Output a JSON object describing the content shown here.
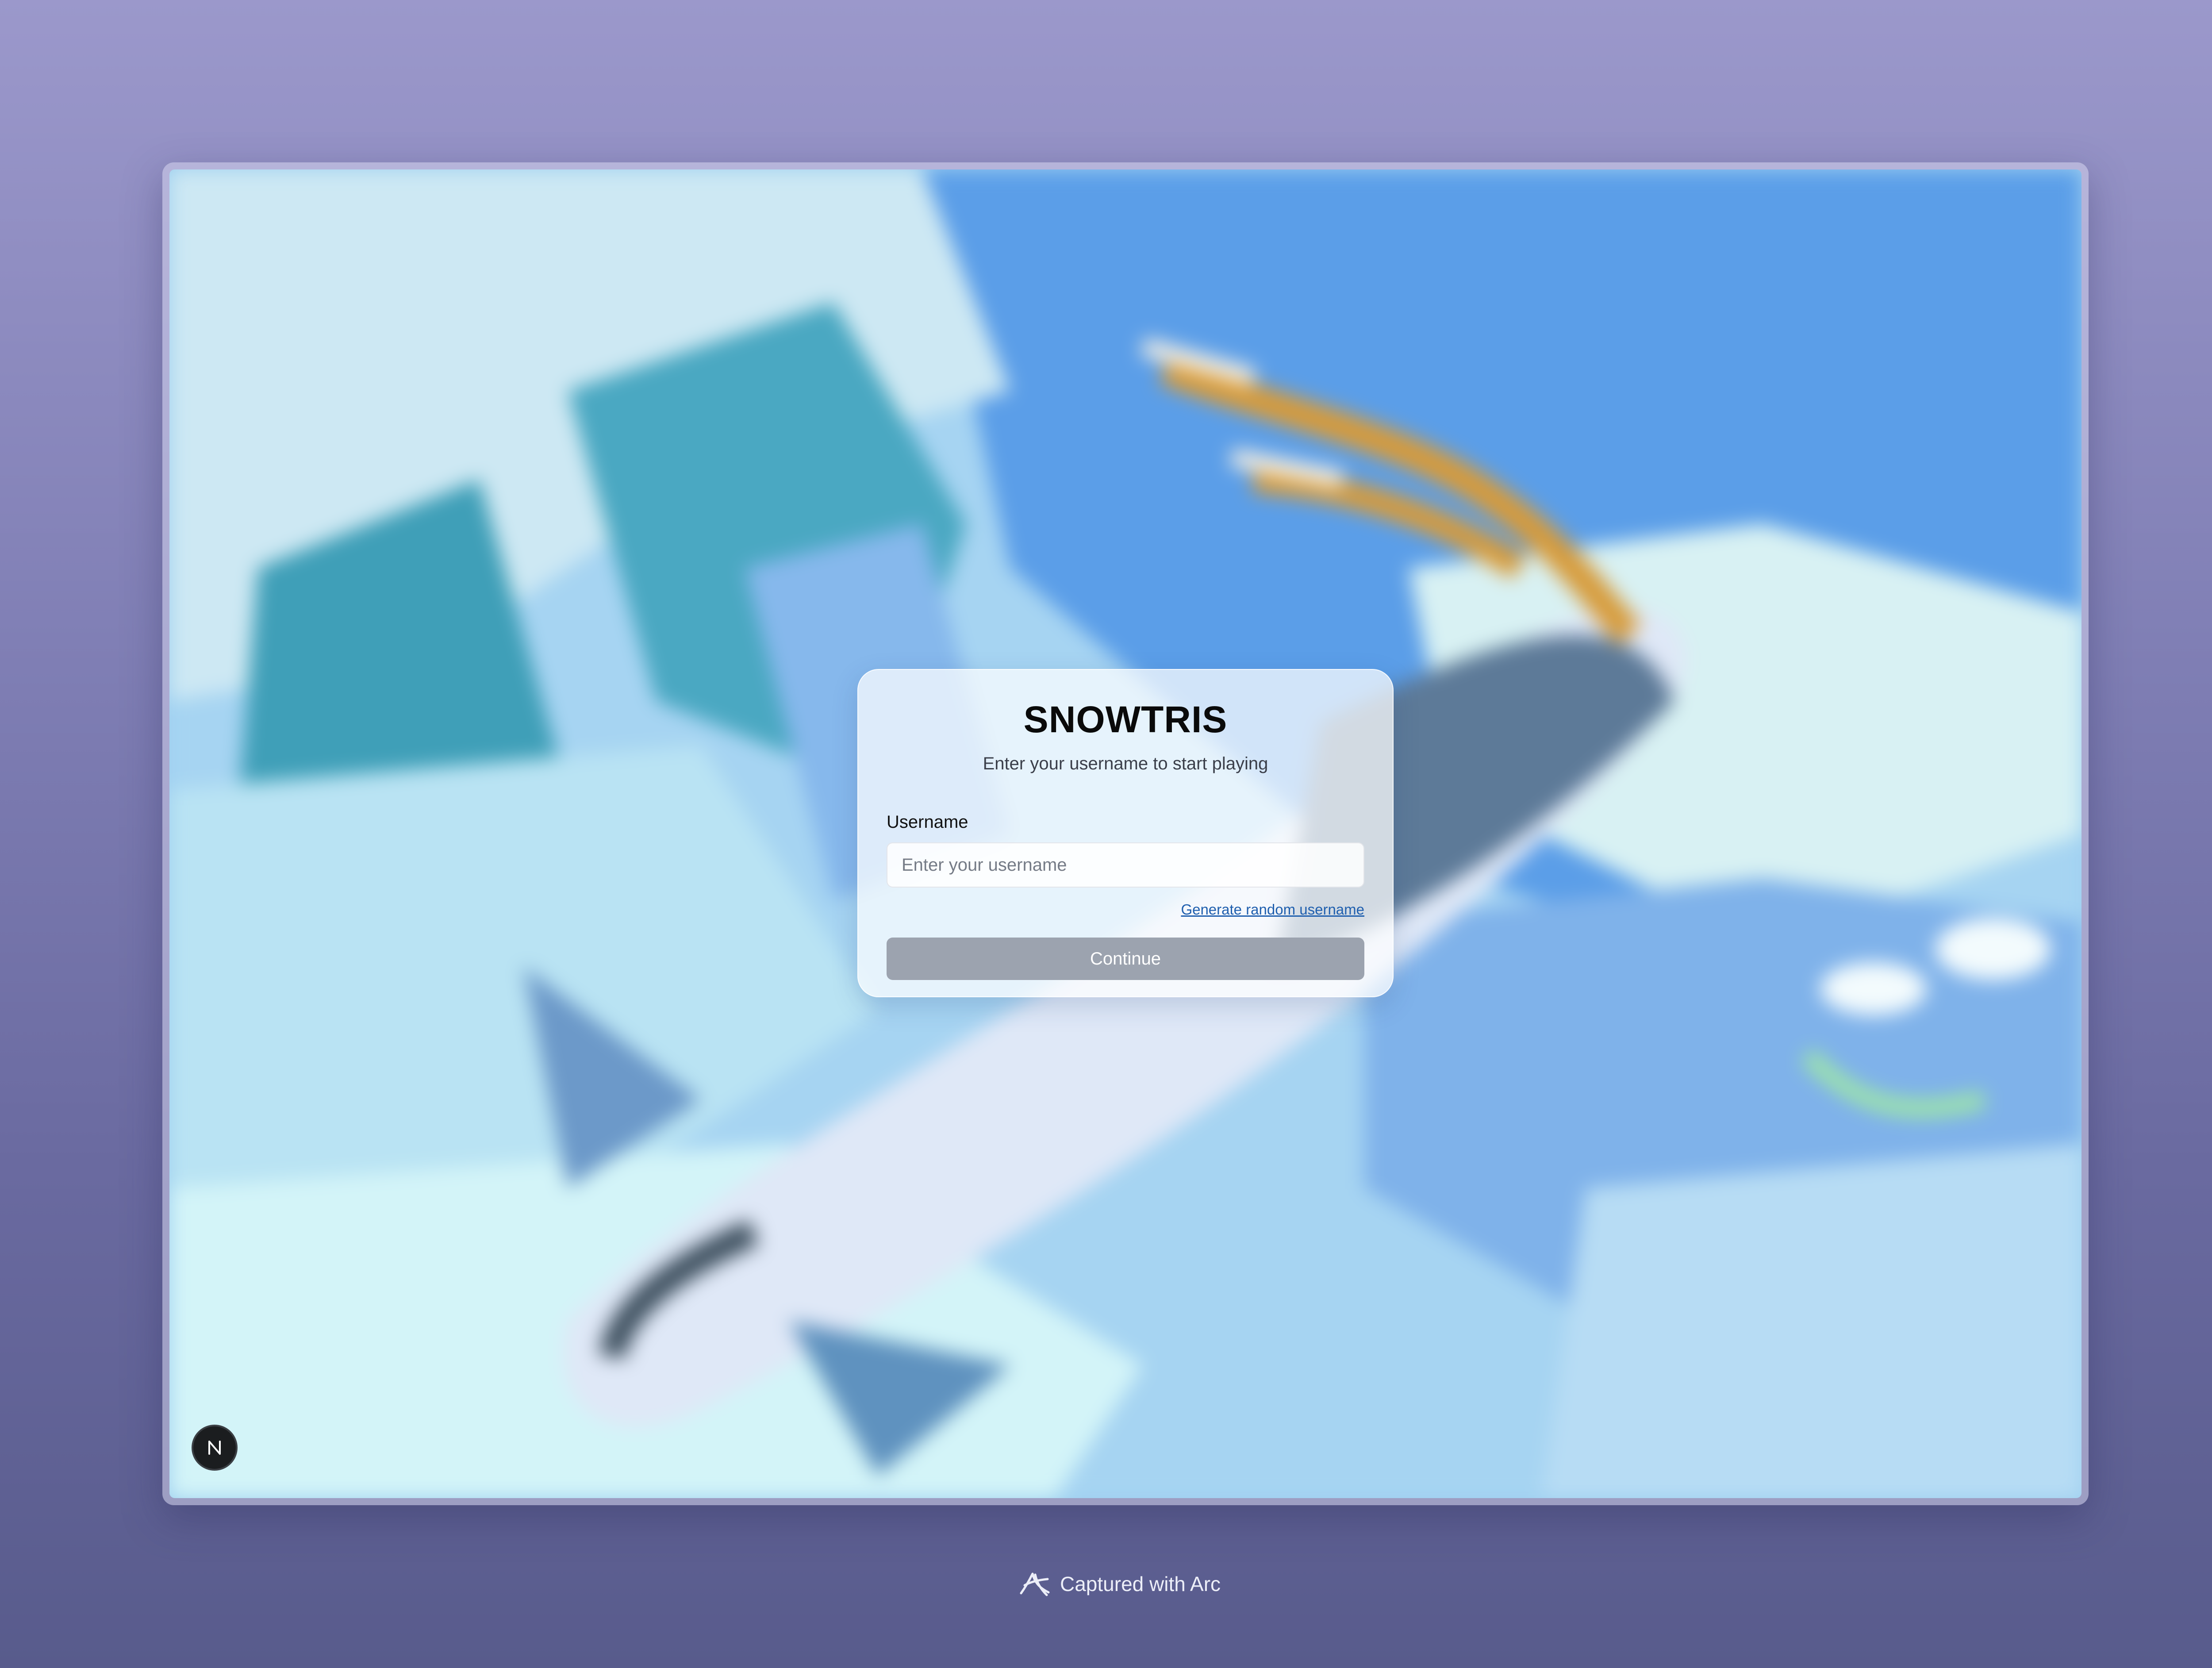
{
  "login": {
    "title": "SNOWTRIS",
    "subtitle": "Enter your username to start playing",
    "username_label": "Username",
    "username_placeholder": "Enter your username",
    "username_value": "",
    "random_link": "Generate random username",
    "continue_label": "Continue"
  },
  "badge": {
    "letter": "N",
    "icon": "next-badge-icon"
  },
  "footer": {
    "caption": "Captured with Arc",
    "icon": "arc-logo-icon"
  },
  "colors": {
    "page_background_top": "#9b98cb",
    "page_background_bottom": "#585b8c",
    "card_background": "#ffffffb8",
    "button_disabled": "#9ca3af",
    "link": "#1f5fae",
    "scene_sky": "#5b9ee8",
    "scene_snow": "#d6f0f6"
  }
}
